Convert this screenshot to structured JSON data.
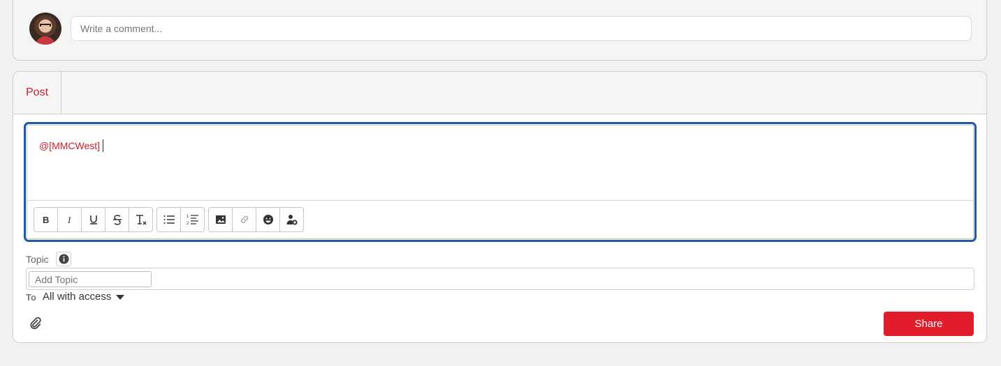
{
  "comment": {
    "placeholder": "Write a comment..."
  },
  "tabs": {
    "post": "Post"
  },
  "editor": {
    "text": "@[MMCWest]"
  },
  "toolbar": {
    "buttons": [
      "bold-icon",
      "italic-icon",
      "underline-icon",
      "strikethrough-icon",
      "clear-format-icon",
      "bullet-list-icon",
      "numbered-list-icon",
      "image-icon",
      "link-icon",
      "emoji-icon",
      "mention-user-icon"
    ]
  },
  "topic": {
    "label": "Topic",
    "placeholder": "Add Topic"
  },
  "audience": {
    "label": "To",
    "value": "All with access"
  },
  "share_label": "Share",
  "colors": {
    "accent_red": "#e31c2c",
    "tab_red": "#c8202f",
    "focus_blue": "#1f5aa8"
  }
}
